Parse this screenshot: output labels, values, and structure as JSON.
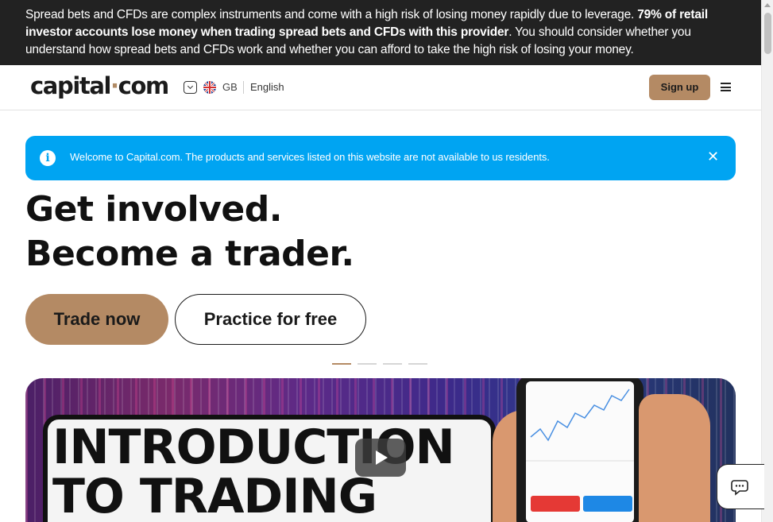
{
  "risk_warning": {
    "text_start": "Spread bets and CFDs are complex instruments and come with a high risk of losing money rapidly due to leverage.",
    "text_bold": "79% of retail investor accounts lose money when trading spread bets and CFDs with this provider",
    "text_end": ". You should consider whether you understand how spread bets and CFDs work and whether you can afford to take the high risk of losing your money."
  },
  "header": {
    "logo_part1": "capital",
    "logo_dot": "·",
    "logo_part2": "com",
    "region": "GB",
    "language": "English",
    "signup_label": "Sign up"
  },
  "notice": {
    "message": "Welcome to Capital.com. The products and services listed on this website are not available to us residents.",
    "info_glyph": "i",
    "close_glyph": "✕"
  },
  "hero": {
    "title_line1": "Get involved.",
    "title_line2": "Become a trader.",
    "trade_now_label": "Trade now",
    "practice_label": "Practice for free"
  },
  "carousel": {
    "slide_count": 4,
    "active_index": 0
  },
  "video": {
    "thumbnail_line1": "INTRODUCTION",
    "thumbnail_line2": "TO TRADING"
  },
  "colors": {
    "accent": "#b48a64",
    "notice_blue": "#00a4f2",
    "banner_dark": "#222222"
  }
}
